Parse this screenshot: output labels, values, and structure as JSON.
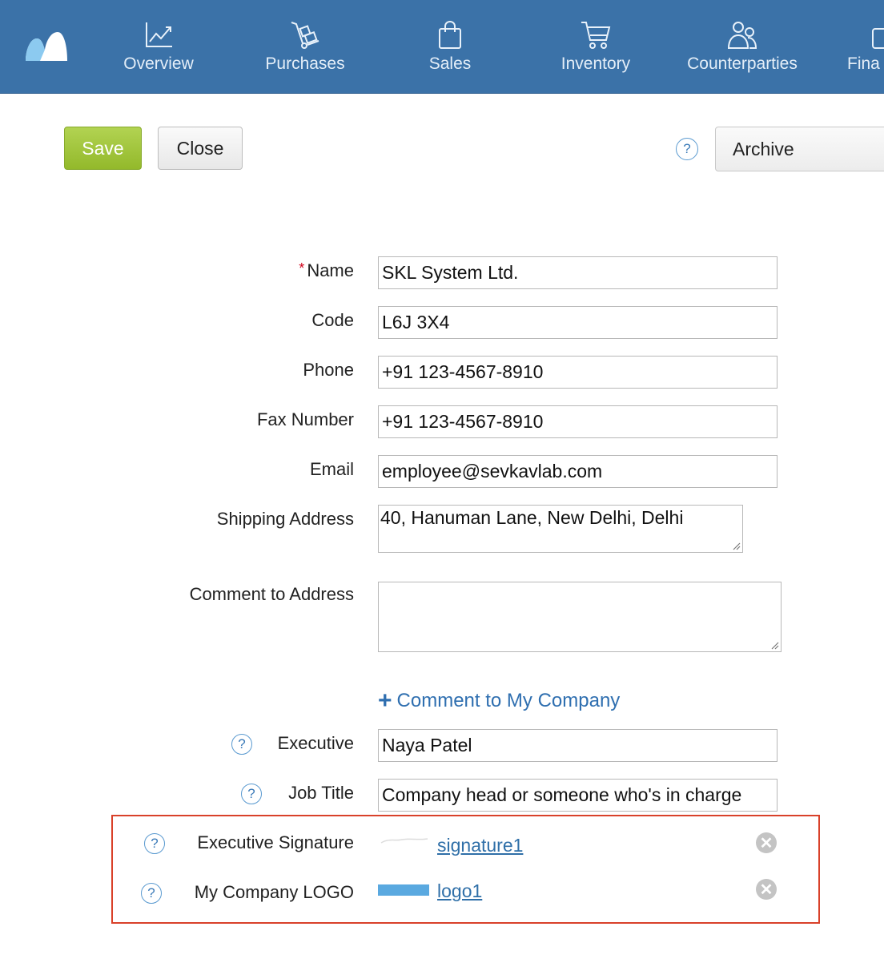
{
  "nav": {
    "items": [
      {
        "label": "Overview",
        "icon": "chart-line-icon"
      },
      {
        "label": "Purchases",
        "icon": "hand-truck-icon"
      },
      {
        "label": "Sales",
        "icon": "shopping-bag-icon"
      },
      {
        "label": "Inventory",
        "icon": "shopping-cart-icon"
      },
      {
        "label": "Counterparties",
        "icon": "people-icon"
      },
      {
        "label": "Fina",
        "icon": "wallet-icon"
      }
    ]
  },
  "toolbar": {
    "save_label": "Save",
    "close_label": "Close",
    "help_label": "?",
    "archive_label": "Archive"
  },
  "form": {
    "name": {
      "label": "Name",
      "required_mark": "*",
      "value": "SKL System Ltd."
    },
    "code": {
      "label": "Code",
      "value": "L6J 3X4"
    },
    "phone": {
      "label": "Phone",
      "value": "+91 123-4567-8910"
    },
    "fax": {
      "label": "Fax Number",
      "value": "+91 123-4567-8910"
    },
    "email": {
      "label": "Email",
      "value": "employee@sevkavlab.com"
    },
    "shipping_address": {
      "label": "Shipping Address",
      "value": "40, Hanuman Lane, New Delhi, Delhi"
    },
    "comment_to_address": {
      "label": "Comment to Address",
      "value": ""
    },
    "add_comment_link": "Comment to My Company",
    "add_comment_plus": "+",
    "executive": {
      "label": "Executive",
      "help": "?",
      "value": "Naya Patel"
    },
    "job_title": {
      "label": "Job Title",
      "help": "?",
      "value": "Company head or someone who's in charge"
    },
    "executive_signature": {
      "label": "Executive Signature",
      "help": "?",
      "file": "signature1",
      "remove": "✕"
    },
    "company_logo": {
      "label": "My Company LOGO",
      "help": "?",
      "file": "logo1",
      "remove": "✕"
    }
  },
  "colors": {
    "header_bg": "#3b72a8",
    "save_green": "#9cc436",
    "link_blue": "#2f6fb0",
    "highlight_red": "#d9412a"
  }
}
